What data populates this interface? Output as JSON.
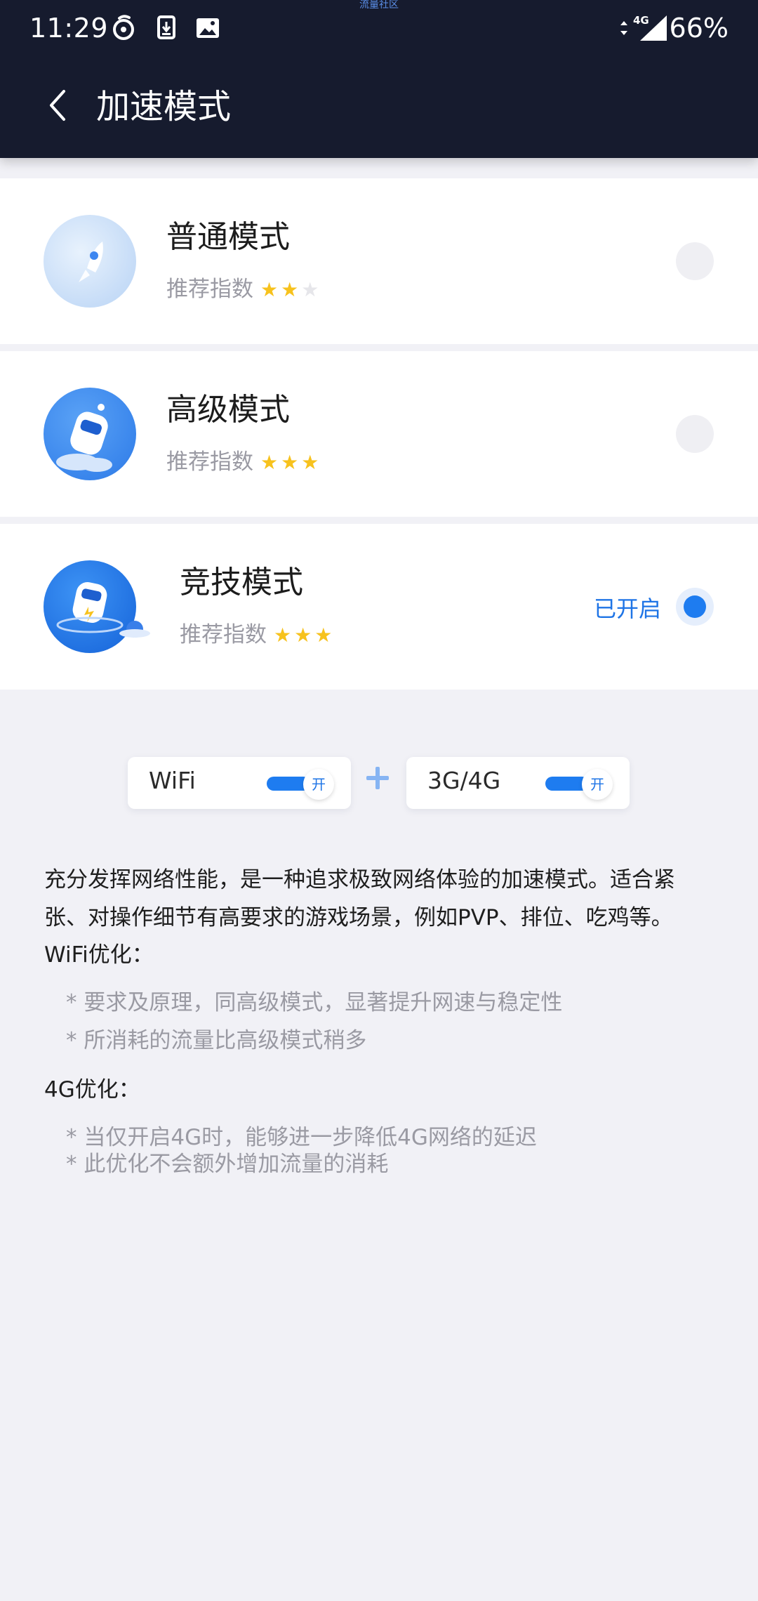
{
  "status_bar": {
    "watermark": "流量社区",
    "time": "11:29",
    "network": "4G",
    "battery": "66%",
    "icons": [
      "netease-music-icon",
      "download-icon",
      "image-icon",
      "data-arrows-icon",
      "signal-icon"
    ]
  },
  "nav": {
    "back_icon": "chevron-left-icon",
    "title": "加速模式"
  },
  "modes": [
    {
      "name": "普通模式",
      "rec_label": "推荐指数",
      "stars": 2,
      "max_stars": 3,
      "selected": false,
      "icon": "rocket-icon"
    },
    {
      "name": "高级模式",
      "rec_label": "推荐指数",
      "stars": 3,
      "max_stars": 3,
      "selected": false,
      "icon": "robot-rocket-icon"
    },
    {
      "name": "竞技模式",
      "rec_label": "推荐指数",
      "stars": 3,
      "max_stars": 3,
      "selected": true,
      "enabled_label": "已开启",
      "icon": "robot-planet-icon"
    }
  ],
  "toggles": {
    "wifi": {
      "label": "WiFi",
      "state": "开",
      "on": true
    },
    "plus": "+",
    "cellular": {
      "label": "3G/4G",
      "state": "开",
      "on": true
    }
  },
  "description": {
    "main": "充分发挥网络性能，是一种追求极致网络体验的加速模式。适合紧张、对操作细节有高要求的游戏场景，例如PVP、排位、吃鸡等。",
    "wifi_heading": "WiFi优化：",
    "wifi_items": [
      "* 要求及原理，同高级模式，显著提升网速与稳定性",
      "* 所消耗的流量比高级模式稍多"
    ],
    "g4_heading": "4G优化：",
    "g4_items": [
      "* 当仅开启4G时，能够进一步降低4G网络的延迟",
      "* 此优化不会额外增加流量的消耗"
    ]
  },
  "colors": {
    "header_bg": "#161b2e",
    "accent": "#1e7cf0",
    "star": "#f7c21d",
    "page_bg": "#f1f1f6"
  }
}
